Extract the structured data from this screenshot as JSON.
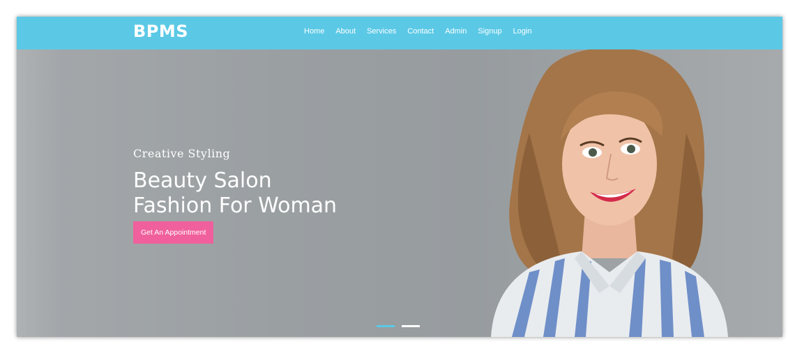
{
  "brand": {
    "name": "BPMS"
  },
  "nav": {
    "items": [
      "Home",
      "About",
      "Services",
      "Contact",
      "Admin",
      "Signup",
      "Login"
    ]
  },
  "hero": {
    "tagline": "Creative Styling",
    "headline_line1": "Beauty Salon",
    "headline_line2": "Fashion For Woman",
    "cta_label": "Get An Appointment"
  },
  "carousel": {
    "slide_count": 2,
    "active_index": 0
  },
  "colors": {
    "navbar": "#5bc9e6",
    "cta": "#f0609c",
    "indicator_active": "#5bc9e6",
    "indicator_inactive": "#ffffff"
  }
}
